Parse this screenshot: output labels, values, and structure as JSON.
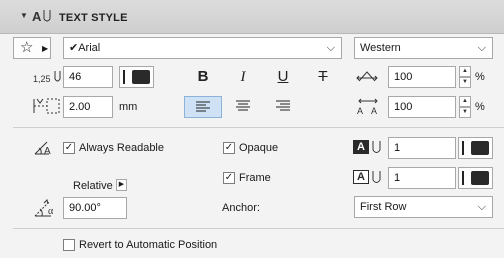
{
  "header": {
    "title": "TEXT STYLE"
  },
  "font": {
    "name": "Arial",
    "script": "Western"
  },
  "size": {
    "value": "46",
    "width_factor": "100",
    "spacing": "100",
    "percent_unit": "%"
  },
  "format": {
    "bold": "B",
    "italic": "I",
    "underline": "U",
    "strike": "T"
  },
  "leading": {
    "value": "2.00",
    "unit": "mm"
  },
  "options": {
    "always_readable": "Always Readable",
    "opaque": "Opaque",
    "frame": "Frame",
    "relative": "Relative",
    "angle": "90.00°",
    "anchor_label": "Anchor:",
    "anchor_value": "First Row",
    "revert": "Revert to Automatic Position"
  },
  "pens": {
    "opaque_pen": "1",
    "frame_pen": "1"
  },
  "colors": {
    "accent": "#cfe1f5",
    "dark_fill": "#2a2a2a"
  }
}
